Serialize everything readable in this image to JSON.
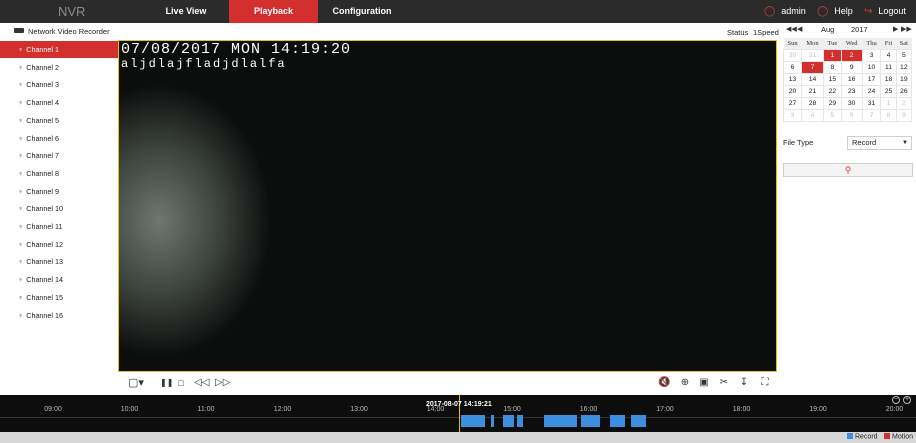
{
  "header": {
    "brand": "NVR",
    "nav": [
      {
        "label": "Live View"
      },
      {
        "label": "Playback"
      },
      {
        "label": "Configuration"
      }
    ],
    "user": "admin",
    "help": "Help",
    "logout": "Logout"
  },
  "sidebar": {
    "title": "Network Video Recorder",
    "channels": [
      "Channel 1",
      "Channel 2",
      "Channel 3",
      "Channel 4",
      "Channel 5",
      "Channel 6",
      "Channel 7",
      "Channel 8",
      "Channel 9",
      "Channel 10",
      "Channel 11",
      "Channel 12",
      "Channel 13",
      "Channel 14",
      "Channel 15",
      "Channel 16"
    ],
    "active_index": 0
  },
  "status_bar": {
    "status_label": "Status",
    "speed_label": "1Speed"
  },
  "video": {
    "osd_time": "07/08/2017 MON 14:19:20",
    "osd_text": "aljdlajfladjdlalfa"
  },
  "calendar": {
    "month": "Aug",
    "year": "2017",
    "weekdays": [
      "Sun",
      "Mon",
      "Tue",
      "Wed",
      "Thu",
      "Fri",
      "Sat"
    ],
    "weeks": [
      [
        "30",
        "31",
        "1",
        "2",
        "3",
        "4",
        "5"
      ],
      [
        "6",
        "7",
        "8",
        "9",
        "10",
        "11",
        "12"
      ],
      [
        "13",
        "14",
        "15",
        "16",
        "17",
        "18",
        "19"
      ],
      [
        "20",
        "21",
        "22",
        "23",
        "24",
        "25",
        "26"
      ],
      [
        "27",
        "28",
        "29",
        "30",
        "31",
        "1",
        "2"
      ],
      [
        "3",
        "4",
        "5",
        "6",
        "7",
        "8",
        "9"
      ]
    ],
    "highlighted": [
      "1",
      "2",
      "7"
    ]
  },
  "search": {
    "file_type_label": "File Type",
    "file_type_value": "Record"
  },
  "timeline": {
    "hours": [
      "09:00",
      "10:00",
      "11:00",
      "12:00",
      "13:00",
      "14:00",
      "15:00",
      "16:00",
      "17:00",
      "18:00",
      "19:00",
      "20:00"
    ],
    "cursor_time": "2017-08-07 14:19:21"
  },
  "legend": {
    "record": "Record",
    "motion": "Motion"
  },
  "colors": {
    "accent": "#d32f2f",
    "record": "#3e8ee0",
    "motion": "#d32f2f",
    "cursor": "#e8c200"
  }
}
